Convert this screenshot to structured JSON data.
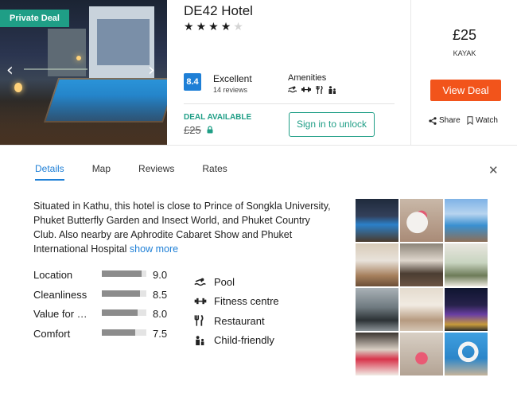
{
  "hotel": {
    "badge": "Private Deal",
    "name": "DE42 Hotel",
    "stars": 4,
    "max_stars": 5,
    "rating": {
      "score": "8.4",
      "label": "Excellent",
      "reviews": "14 reviews"
    },
    "amenities_label": "Amenities",
    "deal_label": "DEAL AVAILABLE",
    "deal_price": "£25",
    "sign_in_label": "Sign in to unlock"
  },
  "pricing": {
    "price": "£25",
    "provider": "KAYAK",
    "view_deal_label": "View Deal",
    "share_label": "Share",
    "watch_label": "Watch"
  },
  "tabs": [
    {
      "label": "Details",
      "active": true
    },
    {
      "label": "Map",
      "active": false
    },
    {
      "label": "Reviews",
      "active": false
    },
    {
      "label": "Rates",
      "active": false
    }
  ],
  "details": {
    "description": "Situated in Kathu, this hotel is close to Prince of Songkla University, Phuket Butterfly Garden and Insect World, and Phuket Country Club. Also nearby are Aphrodite Cabaret Show and Phuket International Hospital",
    "show_more": "show more",
    "ratings": [
      {
        "label": "Location",
        "value": "9.0",
        "score": 9.0
      },
      {
        "label": "Cleanliness",
        "value": "8.5",
        "score": 8.5
      },
      {
        "label": "Value for …",
        "value": "8.0",
        "score": 8.0
      },
      {
        "label": "Comfort",
        "value": "7.5",
        "score": 7.5
      }
    ],
    "amenities": [
      {
        "icon": "pool-icon",
        "label": "Pool"
      },
      {
        "icon": "fitness-icon",
        "label": "Fitness centre"
      },
      {
        "icon": "restaurant-icon",
        "label": "Restaurant"
      },
      {
        "icon": "child-friendly-icon",
        "label": "Child-friendly"
      }
    ]
  },
  "colors": {
    "accent_blue": "#1e7fd6",
    "deal_green": "#1f9e86",
    "cta_orange": "#f2541b"
  }
}
